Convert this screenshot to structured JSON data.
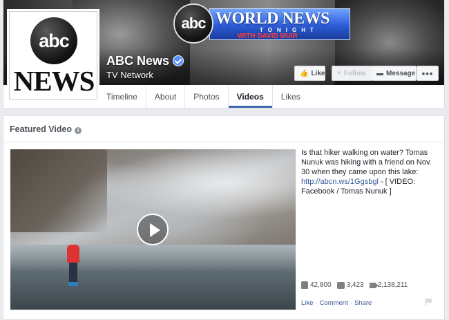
{
  "page": {
    "name": "ABC News",
    "category": "TV Network",
    "profile_logo_text": "abc",
    "profile_logo_word": "NEWS"
  },
  "cover": {
    "logo_circle": "abc",
    "show_title": "WORLD NEWS",
    "show_subtitle": "TONIGHT",
    "with_prefix": "WITH",
    "anchor": "DAVID MUIR"
  },
  "actions": {
    "like_label": "Like",
    "follow_label": "Follow",
    "message_label": "Message",
    "more_label": "•••"
  },
  "tabs": [
    {
      "label": "Timeline",
      "active": false
    },
    {
      "label": "About",
      "active": false
    },
    {
      "label": "Photos",
      "active": false
    },
    {
      "label": "Videos",
      "active": true
    },
    {
      "label": "Likes",
      "active": false
    }
  ],
  "featured": {
    "title": "Featured Video",
    "description_text": "Is that hiker walking on water? Tomas Nunuk was hiking with a friend on Nov. 30 when they came upon this lake: ",
    "link": "http://abcn.ws/1Ggsbgl",
    "description_tail": " - [ VIDEO: Facebook / Tomas Nunuk ]",
    "likes": "42,800",
    "comments": "3,423",
    "views": "2,138,211",
    "action_like": "Like",
    "action_comment": "Comment",
    "action_share": "Share",
    "separator": "·"
  },
  "colors": {
    "accent": "#4267b2",
    "link": "#365899",
    "verified": "#5890ff"
  }
}
